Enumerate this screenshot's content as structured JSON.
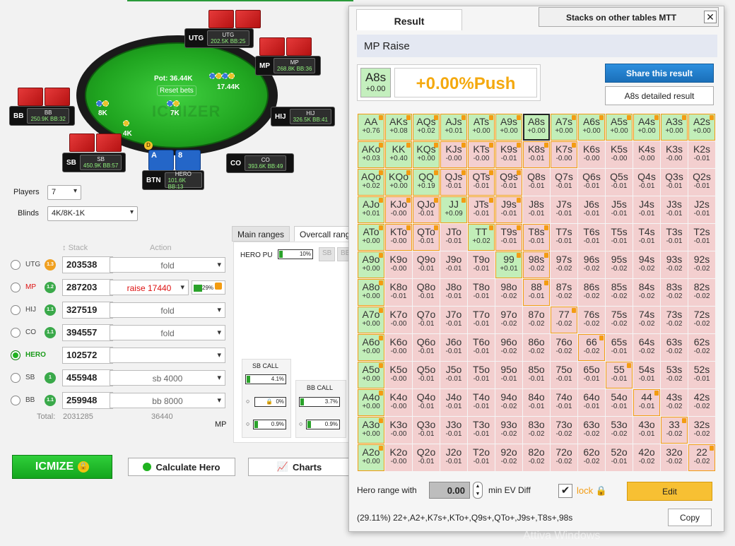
{
  "table": {
    "pot": "Pot: 36.44K",
    "reset_label": "Reset bets",
    "watermark": "ICMIZER",
    "chip_values": {
      "top": "17.44K",
      "left": "8K",
      "mid": "7K",
      "sb": "4K"
    },
    "dealer": "D",
    "seats": [
      {
        "id": "utg",
        "pos": "UTG",
        "name": "UTG",
        "stack": "202.5K",
        "bb": "BB:25"
      },
      {
        "id": "mp",
        "pos": "MP",
        "name": "MP",
        "stack": "268.8K",
        "bb": "BB:36"
      },
      {
        "id": "hij",
        "pos": "HIJ",
        "name": "HIJ",
        "stack": "326.5K",
        "bb": "BB:41"
      },
      {
        "id": "co",
        "pos": "CO",
        "name": "CO",
        "stack": "393.6K",
        "bb": "BB:49"
      },
      {
        "id": "hero",
        "pos": "BTN",
        "name": "HERO",
        "stack": "101.6K",
        "bb": "BB:13"
      },
      {
        "id": "sb",
        "pos": "SB",
        "name": "SB",
        "stack": "450.9K",
        "bb": "BB:57"
      },
      {
        "id": "bb",
        "pos": "BB",
        "name": "BB",
        "stack": "250.9K",
        "bb": "BB:32"
      }
    ],
    "hero_cards": [
      "A",
      "8"
    ]
  },
  "settings": {
    "players_label": "Players",
    "players_value": "7",
    "blinds_label": "Blinds",
    "blinds_value": "4K/8K-1K"
  },
  "positions": {
    "stack_header": "Stack",
    "action_header": "Action",
    "rows": [
      {
        "name": "UTG",
        "badge": "1.3",
        "stack": "203538",
        "action": "fold"
      },
      {
        "name": "MP",
        "badge": "1.2",
        "stack": "287203",
        "action": "raise 17440",
        "pct": "29%"
      },
      {
        "name": "HIJ",
        "badge": "1.1",
        "stack": "327519",
        "action": "fold"
      },
      {
        "name": "CO",
        "badge": "1.1",
        "stack": "394557",
        "action": "fold"
      },
      {
        "name": "HERO",
        "badge": "",
        "stack": "102572",
        "action": ""
      },
      {
        "name": "SB",
        "badge": "1",
        "stack": "455948",
        "action": "sb 4000"
      },
      {
        "name": "BB",
        "badge": "1.1",
        "stack": "259948",
        "action": "bb 8000"
      }
    ],
    "total_label": "Total:",
    "total_stack": "2031285",
    "total_pot": "36440",
    "current": "MP"
  },
  "ranges": {
    "tab_main": "Main ranges",
    "tab_overcall": "Overcall rang",
    "hero_push_label": "HERO PU",
    "hero_push_pct": "10%",
    "sub_tabs": [
      "SB",
      "BB"
    ],
    "sb_call_label": "SB CALL",
    "sb_call_pct": "4.1%",
    "sb_row2_pct": "0%",
    "sb_row3_pct": "0.9%",
    "bb_call_label": "BB CALL",
    "bb_call_pct": "3.7%",
    "bb_row2_pct": "0.9%"
  },
  "buttons": {
    "icmize": "ICMIZE",
    "calculate": "Calculate Hero",
    "charts": "Charts"
  },
  "result": {
    "tab_result": "Result",
    "tab_other": "Stacks on other tables MTT",
    "close": "✕",
    "title": "MP Raise",
    "hand": "A8s",
    "hand_ev": "+0.00",
    "hand_result": "+0.00%Push",
    "share": "Share this result",
    "detail": "A8s detailed result",
    "hero_range_label": "Hero range with",
    "hero_range_value": "0.00",
    "min_ev_label": "min EV Diff",
    "lock_label": "lock",
    "edit": "Edit",
    "range_string": "(29.11%) 22+,A2+,K7s+,KTo+,Q9s+,QTo+,J9s+,T8s+,98s",
    "copy": "Copy"
  },
  "grid": [
    [
      [
        "AA",
        "+0.76",
        "g",
        1
      ],
      [
        "AKs",
        "+0.08",
        "g",
        1
      ],
      [
        "AQs",
        "+0.02",
        "g",
        1
      ],
      [
        "AJs",
        "+0.01",
        "g",
        1
      ],
      [
        "ATs",
        "+0.00",
        "g",
        1
      ],
      [
        "A9s",
        "+0.00",
        "g",
        1
      ],
      [
        "A8s",
        "+0.00",
        "g",
        2
      ],
      [
        "A7s",
        "+0.00",
        "g",
        1
      ],
      [
        "A6s",
        "+0.00",
        "g",
        1
      ],
      [
        "A5s",
        "+0.00",
        "g",
        1
      ],
      [
        "A4s",
        "+0.00",
        "g",
        1
      ],
      [
        "A3s",
        "+0.00",
        "g",
        1
      ],
      [
        "A2s",
        "+0.00",
        "g",
        1
      ]
    ],
    [
      [
        "AKo",
        "+0.03",
        "g",
        1
      ],
      [
        "KK",
        "+0.40",
        "g",
        1
      ],
      [
        "KQs",
        "+0.00",
        "g",
        1
      ],
      [
        "KJs",
        "-0.00",
        "r",
        1
      ],
      [
        "KTs",
        "-0.00",
        "r",
        1
      ],
      [
        "K9s",
        "-0.01",
        "r",
        1
      ],
      [
        "K8s",
        "-0.01",
        "r",
        1
      ],
      [
        "K7s",
        "-0.00",
        "r",
        1
      ],
      [
        "K6s",
        "-0.00",
        "r",
        0
      ],
      [
        "K5s",
        "-0.00",
        "r",
        0
      ],
      [
        "K4s",
        "-0.00",
        "r",
        0
      ],
      [
        "K3s",
        "-0.00",
        "r",
        0
      ],
      [
        "K2s",
        "-0.01",
        "r",
        0
      ]
    ],
    [
      [
        "AQo",
        "+0.02",
        "g",
        1
      ],
      [
        "KQo",
        "+0.00",
        "g",
        1
      ],
      [
        "QQ",
        "+0.19",
        "g",
        1
      ],
      [
        "QJs",
        "-0.01",
        "r",
        1
      ],
      [
        "QTs",
        "-0.01",
        "r",
        1
      ],
      [
        "Q9s",
        "-0.01",
        "r",
        1
      ],
      [
        "Q8s",
        "-0.01",
        "r",
        0
      ],
      [
        "Q7s",
        "-0.01",
        "r",
        0
      ],
      [
        "Q6s",
        "-0.01",
        "r",
        0
      ],
      [
        "Q5s",
        "-0.01",
        "r",
        0
      ],
      [
        "Q4s",
        "-0.01",
        "r",
        0
      ],
      [
        "Q3s",
        "-0.01",
        "r",
        0
      ],
      [
        "Q2s",
        "-0.01",
        "r",
        0
      ]
    ],
    [
      [
        "AJo",
        "+0.01",
        "g",
        1
      ],
      [
        "KJo",
        "-0.00",
        "r",
        1
      ],
      [
        "QJo",
        "-0.01",
        "r",
        1
      ],
      [
        "JJ",
        "+0.09",
        "g",
        1
      ],
      [
        "JTs",
        "-0.01",
        "r",
        1
      ],
      [
        "J9s",
        "-0.01",
        "r",
        1
      ],
      [
        "J8s",
        "-0.01",
        "r",
        0
      ],
      [
        "J7s",
        "-0.01",
        "r",
        0
      ],
      [
        "J6s",
        "-0.01",
        "r",
        0
      ],
      [
        "J5s",
        "-0.01",
        "r",
        0
      ],
      [
        "J4s",
        "-0.01",
        "r",
        0
      ],
      [
        "J3s",
        "-0.01",
        "r",
        0
      ],
      [
        "J2s",
        "-0.01",
        "r",
        0
      ]
    ],
    [
      [
        "ATo",
        "+0.00",
        "g",
        1
      ],
      [
        "KTo",
        "-0.00",
        "r",
        1
      ],
      [
        "QTo",
        "-0.01",
        "r",
        1
      ],
      [
        "JTo",
        "-0.01",
        "r",
        0
      ],
      [
        "TT",
        "+0.02",
        "g",
        1
      ],
      [
        "T9s",
        "-0.01",
        "r",
        1
      ],
      [
        "T8s",
        "-0.01",
        "r",
        1
      ],
      [
        "T7s",
        "-0.01",
        "r",
        0
      ],
      [
        "T6s",
        "-0.01",
        "r",
        0
      ],
      [
        "T5s",
        "-0.01",
        "r",
        0
      ],
      [
        "T4s",
        "-0.01",
        "r",
        0
      ],
      [
        "T3s",
        "-0.01",
        "r",
        0
      ],
      [
        "T2s",
        "-0.01",
        "r",
        0
      ]
    ],
    [
      [
        "A9o",
        "+0.00",
        "g",
        1
      ],
      [
        "K9o",
        "-0.00",
        "r",
        0
      ],
      [
        "Q9o",
        "-0.01",
        "r",
        0
      ],
      [
        "J9o",
        "-0.01",
        "r",
        0
      ],
      [
        "T9o",
        "-0.01",
        "r",
        0
      ],
      [
        "99",
        "+0.01",
        "g",
        1
      ],
      [
        "98s",
        "-0.02",
        "r",
        1
      ],
      [
        "97s",
        "-0.02",
        "r",
        0
      ],
      [
        "96s",
        "-0.02",
        "r",
        0
      ],
      [
        "95s",
        "-0.02",
        "r",
        0
      ],
      [
        "94s",
        "-0.02",
        "r",
        0
      ],
      [
        "93s",
        "-0.02",
        "r",
        0
      ],
      [
        "92s",
        "-0.02",
        "r",
        0
      ]
    ],
    [
      [
        "A8o",
        "+0.00",
        "g",
        1
      ],
      [
        "K8o",
        "-0.01",
        "r",
        0
      ],
      [
        "Q8o",
        "-0.01",
        "r",
        0
      ],
      [
        "J8o",
        "-0.01",
        "r",
        0
      ],
      [
        "T8o",
        "-0.01",
        "r",
        0
      ],
      [
        "98o",
        "-0.02",
        "r",
        0
      ],
      [
        "88",
        "-0.01",
        "r",
        1
      ],
      [
        "87s",
        "-0.02",
        "r",
        0
      ],
      [
        "86s",
        "-0.02",
        "r",
        0
      ],
      [
        "85s",
        "-0.02",
        "r",
        0
      ],
      [
        "84s",
        "-0.02",
        "r",
        0
      ],
      [
        "83s",
        "-0.02",
        "r",
        0
      ],
      [
        "82s",
        "-0.02",
        "r",
        0
      ]
    ],
    [
      [
        "A7o",
        "+0.00",
        "g",
        1
      ],
      [
        "K7o",
        "-0.00",
        "r",
        0
      ],
      [
        "Q7o",
        "-0.01",
        "r",
        0
      ],
      [
        "J7o",
        "-0.01",
        "r",
        0
      ],
      [
        "T7o",
        "-0.01",
        "r",
        0
      ],
      [
        "97o",
        "-0.02",
        "r",
        0
      ],
      [
        "87o",
        "-0.02",
        "r",
        0
      ],
      [
        "77",
        "-0.02",
        "r",
        1
      ],
      [
        "76s",
        "-0.02",
        "r",
        0
      ],
      [
        "75s",
        "-0.02",
        "r",
        0
      ],
      [
        "74s",
        "-0.02",
        "r",
        0
      ],
      [
        "73s",
        "-0.02",
        "r",
        0
      ],
      [
        "72s",
        "-0.02",
        "r",
        0
      ]
    ],
    [
      [
        "A6o",
        "+0.00",
        "g",
        1
      ],
      [
        "K6o",
        "-0.00",
        "r",
        0
      ],
      [
        "Q6o",
        "-0.01",
        "r",
        0
      ],
      [
        "J6o",
        "-0.01",
        "r",
        0
      ],
      [
        "T6o",
        "-0.01",
        "r",
        0
      ],
      [
        "96o",
        "-0.02",
        "r",
        0
      ],
      [
        "86o",
        "-0.02",
        "r",
        0
      ],
      [
        "76o",
        "-0.02",
        "r",
        0
      ],
      [
        "66",
        "-0.02",
        "r",
        1
      ],
      [
        "65s",
        "-0.01",
        "r",
        0
      ],
      [
        "64s",
        "-0.02",
        "r",
        0
      ],
      [
        "63s",
        "-0.02",
        "r",
        0
      ],
      [
        "62s",
        "-0.02",
        "r",
        0
      ]
    ],
    [
      [
        "A5o",
        "+0.00",
        "g",
        1
      ],
      [
        "K5o",
        "-0.00",
        "r",
        0
      ],
      [
        "Q5o",
        "-0.01",
        "r",
        0
      ],
      [
        "J5o",
        "-0.01",
        "r",
        0
      ],
      [
        "T5o",
        "-0.01",
        "r",
        0
      ],
      [
        "95o",
        "-0.01",
        "r",
        0
      ],
      [
        "85o",
        "-0.01",
        "r",
        0
      ],
      [
        "75o",
        "-0.01",
        "r",
        0
      ],
      [
        "65o",
        "-0.01",
        "r",
        0
      ],
      [
        "55",
        "-0.01",
        "r",
        1
      ],
      [
        "54s",
        "-0.01",
        "r",
        0
      ],
      [
        "53s",
        "-0.02",
        "r",
        0
      ],
      [
        "52s",
        "-0.01",
        "r",
        0
      ]
    ],
    [
      [
        "A4o",
        "+0.00",
        "g",
        1
      ],
      [
        "K4o",
        "-0.00",
        "r",
        0
      ],
      [
        "Q4o",
        "-0.01",
        "r",
        0
      ],
      [
        "J4o",
        "-0.01",
        "r",
        0
      ],
      [
        "T4o",
        "-0.01",
        "r",
        0
      ],
      [
        "94o",
        "-0.02",
        "r",
        0
      ],
      [
        "84o",
        "-0.01",
        "r",
        0
      ],
      [
        "74o",
        "-0.01",
        "r",
        0
      ],
      [
        "64o",
        "-0.01",
        "r",
        0
      ],
      [
        "54o",
        "-0.01",
        "r",
        0
      ],
      [
        "44",
        "-0.01",
        "r",
        1
      ],
      [
        "43s",
        "-0.02",
        "r",
        0
      ],
      [
        "42s",
        "-0.02",
        "r",
        0
      ]
    ],
    [
      [
        "A3o",
        "+0.00",
        "g",
        1
      ],
      [
        "K3o",
        "-0.00",
        "r",
        0
      ],
      [
        "Q3o",
        "-0.01",
        "r",
        0
      ],
      [
        "J3o",
        "-0.01",
        "r",
        0
      ],
      [
        "T3o",
        "-0.01",
        "r",
        0
      ],
      [
        "93o",
        "-0.02",
        "r",
        0
      ],
      [
        "83o",
        "-0.02",
        "r",
        0
      ],
      [
        "73o",
        "-0.02",
        "r",
        0
      ],
      [
        "63o",
        "-0.02",
        "r",
        0
      ],
      [
        "53o",
        "-0.02",
        "r",
        0
      ],
      [
        "43o",
        "-0.01",
        "r",
        0
      ],
      [
        "33",
        "-0.02",
        "r",
        1
      ],
      [
        "32s",
        "-0.02",
        "r",
        0
      ]
    ],
    [
      [
        "A2o",
        "+0.00",
        "g",
        1
      ],
      [
        "K2o",
        "-0.00",
        "r",
        0
      ],
      [
        "Q2o",
        "-0.01",
        "r",
        0
      ],
      [
        "J2o",
        "-0.01",
        "r",
        0
      ],
      [
        "T2o",
        "-0.01",
        "r",
        0
      ],
      [
        "92o",
        "-0.02",
        "r",
        0
      ],
      [
        "82o",
        "-0.02",
        "r",
        0
      ],
      [
        "72o",
        "-0.02",
        "r",
        0
      ],
      [
        "62o",
        "-0.02",
        "r",
        0
      ],
      [
        "52o",
        "-0.01",
        "r",
        0
      ],
      [
        "42o",
        "-0.02",
        "r",
        0
      ],
      [
        "32o",
        "-0.02",
        "r",
        0
      ],
      [
        "22",
        "-0.02",
        "r",
        1
      ]
    ]
  ],
  "os_watermark": "Attiva Windows"
}
